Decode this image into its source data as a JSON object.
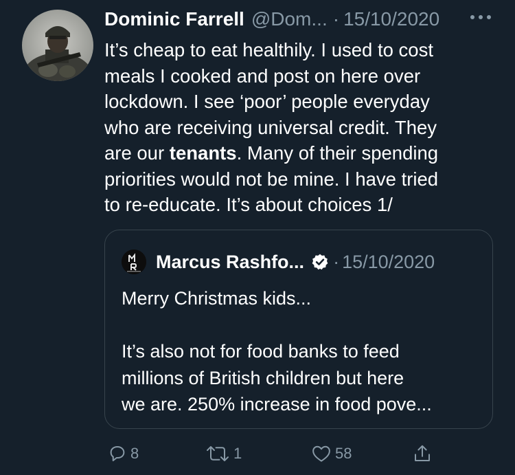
{
  "tweet": {
    "author_name": "Dominic Farrell",
    "handle": "@Dom...",
    "separator": "·",
    "date": "15/10/2020",
    "more_label": "···",
    "text_lines": [
      "It’s cheap to eat healthily. I used to cost",
      "meals I cooked and post on here over",
      "lockdown. I see ‘poor’ people everyday",
      "who are receiving universal credit. They"
    ],
    "line5_before": "are our ",
    "line5_bold": "tenants",
    "line5_after": ". Many of their spending",
    "text_lines_end": [
      "priorities would not be mine. I have tried",
      "to re-educate. It’s about choices 1/"
    ]
  },
  "quoted_tweet": {
    "avatar_text": "M\nR",
    "author_name": "Marcus Rashfo...",
    "verified_icon": "verified-badge-icon",
    "separator": "·",
    "date": "15/10/2020",
    "text_lines": [
      "Merry Christmas kids...",
      "",
      "It’s also not for food banks to feed",
      "millions of British children but here",
      "we are. 250% increase in food pove..."
    ]
  },
  "actions": {
    "reply": {
      "icon": "reply-icon",
      "count": "8"
    },
    "retweet": {
      "icon": "retweet-icon",
      "count": "1"
    },
    "like": {
      "icon": "heart-icon",
      "count": "58"
    },
    "share": {
      "icon": "share-icon"
    }
  },
  "colors": {
    "background": "#15202b",
    "text": "#ffffff",
    "secondary": "#8899a6",
    "border": "#38444d"
  }
}
